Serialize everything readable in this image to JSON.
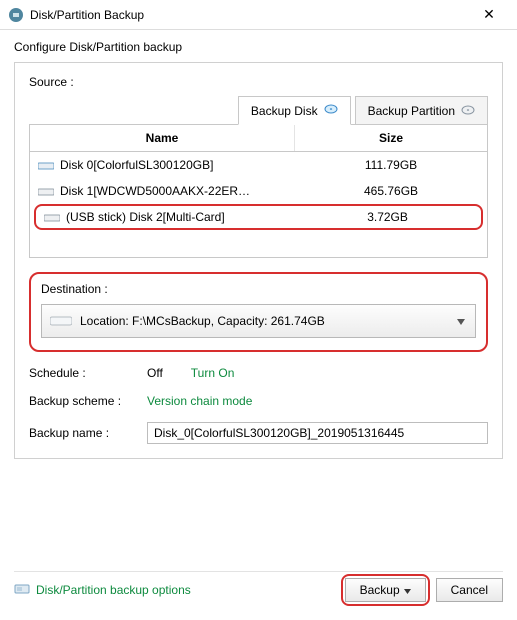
{
  "window": {
    "title": "Disk/Partition Backup",
    "close_glyph": "✕"
  },
  "subtitle": "Configure Disk/Partition backup",
  "source": {
    "label": "Source :",
    "tabs": {
      "disk": "Backup Disk",
      "partition": "Backup Partition"
    },
    "columns": {
      "name": "Name",
      "size": "Size"
    },
    "rows": [
      {
        "name": "Disk 0[ColorfulSL300120GB]",
        "size": "111.79GB"
      },
      {
        "name": "Disk 1[WDCWD5000AAKX-22ER…",
        "size": "465.76GB"
      },
      {
        "name": "(USB stick) Disk 2[Multi-Card]",
        "size": "3.72GB"
      }
    ]
  },
  "destination": {
    "label": "Destination :",
    "value": "Location: F:\\MCsBackup, Capacity: 261.74GB"
  },
  "schedule": {
    "label": "Schedule :",
    "status": "Off",
    "turn_on": "Turn On"
  },
  "scheme": {
    "label": "Backup scheme :",
    "value": "Version chain mode"
  },
  "backup_name": {
    "label": "Backup name :",
    "value": "Disk_0[ColorfulSL300120GB]_2019051316445"
  },
  "footer": {
    "options": "Disk/Partition backup options",
    "backup": "Backup",
    "cancel": "Cancel"
  }
}
